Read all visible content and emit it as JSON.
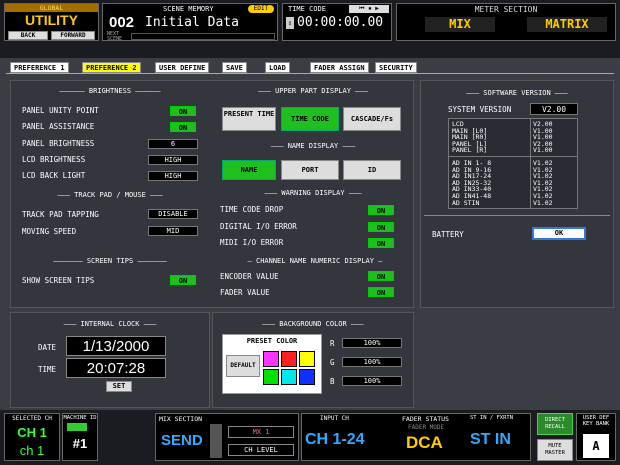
{
  "header": {
    "global_label": "GLOBAL",
    "utility": "UTILITY",
    "back": "BACK",
    "forward": "FORWARD",
    "scene_memory": "SCENE MEMORY",
    "edit": "EDIT",
    "scene_number": "002",
    "scene_title": "Initial Data",
    "next_scene": "NEXT SCENE",
    "time_code": "TIME CODE",
    "tc_value": "00:00:00.00",
    "meter_section": "METER SECTION",
    "mix": "MIX",
    "matrix": "MATRIX"
  },
  "tabs": [
    "PREFERENCE 1",
    "PREFERENCE 2",
    "USER DEFINE",
    "SAVE",
    "LOAD",
    "FADER ASSIGN",
    "SECURITY"
  ],
  "brightness": {
    "title": "BRIGHTNESS",
    "rows": [
      {
        "label": "PANEL UNITY POINT",
        "value": "ON"
      },
      {
        "label": "PANEL ASSISTANCE",
        "value": "ON"
      },
      {
        "label": "PANEL BRIGHTNESS",
        "value": "6"
      },
      {
        "label": "LCD BRIGHTNESS",
        "value": "HIGH"
      },
      {
        "label": "LCD BACK LIGHT",
        "value": "HIGH"
      }
    ]
  },
  "trackpad": {
    "title": "TRACK PAD / MOUSE",
    "rows": [
      {
        "label": "TRACK PAD TAPPING",
        "value": "DISABLE"
      },
      {
        "label": "MOVING SPEED",
        "value": "MID"
      }
    ]
  },
  "screentips": {
    "title": "SCREEN TIPS",
    "label": "SHOW SCREEN TIPS",
    "value": "ON"
  },
  "upper": {
    "title": "UPPER PART DISPLAY",
    "b1": "PRESENT TIME",
    "b2": "TIME CODE",
    "b3": "CASCADE/Fs"
  },
  "namedisp": {
    "title": "NAME DISPLAY",
    "b1": "NAME",
    "b2": "PORT",
    "b3": "ID"
  },
  "warning": {
    "title": "WARNING DISPLAY",
    "rows": [
      {
        "label": "TIME CODE DROP",
        "value": "ON"
      },
      {
        "label": "DIGITAL I/O ERROR",
        "value": "ON"
      },
      {
        "label": "MIDI I/O ERROR",
        "value": "ON"
      }
    ]
  },
  "chname": {
    "title": "CHANNEL NAME NUMERIC DISPLAY",
    "rows": [
      {
        "label": "ENCODER VALUE",
        "value": "ON"
      },
      {
        "label": "FADER VALUE",
        "value": "ON"
      }
    ]
  },
  "software": {
    "title": "SOFTWARE VERSION",
    "sys_label": "SYSTEM VERSION",
    "sys_value": "V2.00",
    "left1": "LCD\nMAIN [L0]\nMAIN [R0]\nPANEL [L]\nPANEL [R]",
    "right1": "V2.00\nV1.00\nV1.00\nV2.00\nV1.00",
    "left2": "AD IN 1- 8\nAD IN 9-16\nAD IN17-24\nAD IN25-32\nAD IN33-40\nAD IN41-48\nAD STIN",
    "right2": "V1.02\nV1.02\nV1.02\nV1.02\nV1.02\nV1.02\nV1.02"
  },
  "battery": {
    "label": "BATTERY",
    "value": "OK"
  },
  "clock": {
    "title": "INTERNAL CLOCK",
    "date_label": "DATE",
    "date": "1/13/2000",
    "time_label": "TIME",
    "time": "20:07:28",
    "set": "SET"
  },
  "bg": {
    "title": "BACKGROUND COLOR",
    "preset": "PRESET COLOR",
    "default": "DEFAULT",
    "r": "R",
    "g": "G",
    "b": "B",
    "rv": "100%",
    "gv": "100%",
    "bv": "100%"
  },
  "footer": {
    "selected_ch": "SELECTED CH",
    "ch1": "CH 1",
    "ch1b": "ch 1",
    "machine_id": "MACHINE ID",
    "mid_num": "#1",
    "mix_section": "MIX SECTION",
    "send": "SEND",
    "mx": "MX 1",
    "chlevel": "CH LEVEL",
    "input_ch": "INPUT CH",
    "fader_status": "FADER STATUS",
    "ststin": "ST IN / FXRTN",
    "input_range": "CH 1-24",
    "fader_mode": "FADER MODE",
    "dca": "DCA",
    "st_in": "ST IN",
    "direct": "DIRECT RECALL",
    "user_def": "USER DEF KEY BANK",
    "mute": "MUTE MASTER",
    "bank": "A"
  }
}
